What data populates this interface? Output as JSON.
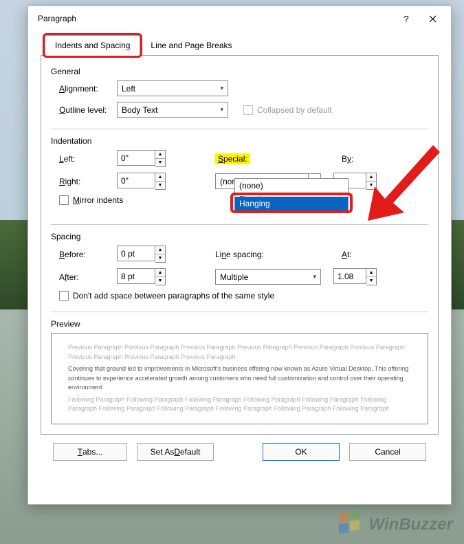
{
  "title": "Paragraph",
  "tabs": {
    "spacing": "Indents and Spacing",
    "breaks": "Line and Page Breaks"
  },
  "general": {
    "head": "General",
    "alignment_label": "Alignment:",
    "alignment_value": "Left",
    "outline_label": "Outline level:",
    "outline_value": "Body Text",
    "collapsed_label": "Collapsed by default"
  },
  "indentation": {
    "head": "Indentation",
    "left_label": "Left:",
    "left_value": "0\"",
    "right_label": "Right:",
    "right_value": "0\"",
    "special_label": "Special:",
    "special_value": "(none)",
    "by_label": "By:",
    "by_value": "",
    "mirror_label": "Mirror indents",
    "options": {
      "none": "(none)",
      "firstline": "First line",
      "hanging": "Hanging"
    }
  },
  "spacing": {
    "head": "Spacing",
    "before_label": "Before:",
    "before_value": "0 pt",
    "after_label": "After:",
    "after_value": "8 pt",
    "linespacing_label": "Line spacing:",
    "linespacing_value": "Multiple",
    "at_label": "At:",
    "at_value": "1.08",
    "noadd_label": "Don't add space between paragraphs of the same style"
  },
  "preview": {
    "head": "Preview",
    "before": "Previous Paragraph Previous Paragraph Previous Paragraph Previous Paragraph Previous Paragraph Previous Paragraph Previous Paragraph Previous Paragraph Previous Paragraph",
    "sample": "Covering that ground led to improvements in Microsoft's business offering now known as Azure Virtual Desktop. This offering continues to experience accelerated growth among customers who need full customization and control over their operating environment",
    "after": "Following Paragraph Following Paragraph Following Paragraph Following Paragraph Following Paragraph Following Paragraph Following Paragraph Following Paragraph Following Paragraph Following Paragraph Following Paragraph"
  },
  "buttons": {
    "tabs": "Tabs...",
    "default": "Set As Default",
    "ok": "OK",
    "cancel": "Cancel"
  },
  "watermark": "WinBuzzer"
}
